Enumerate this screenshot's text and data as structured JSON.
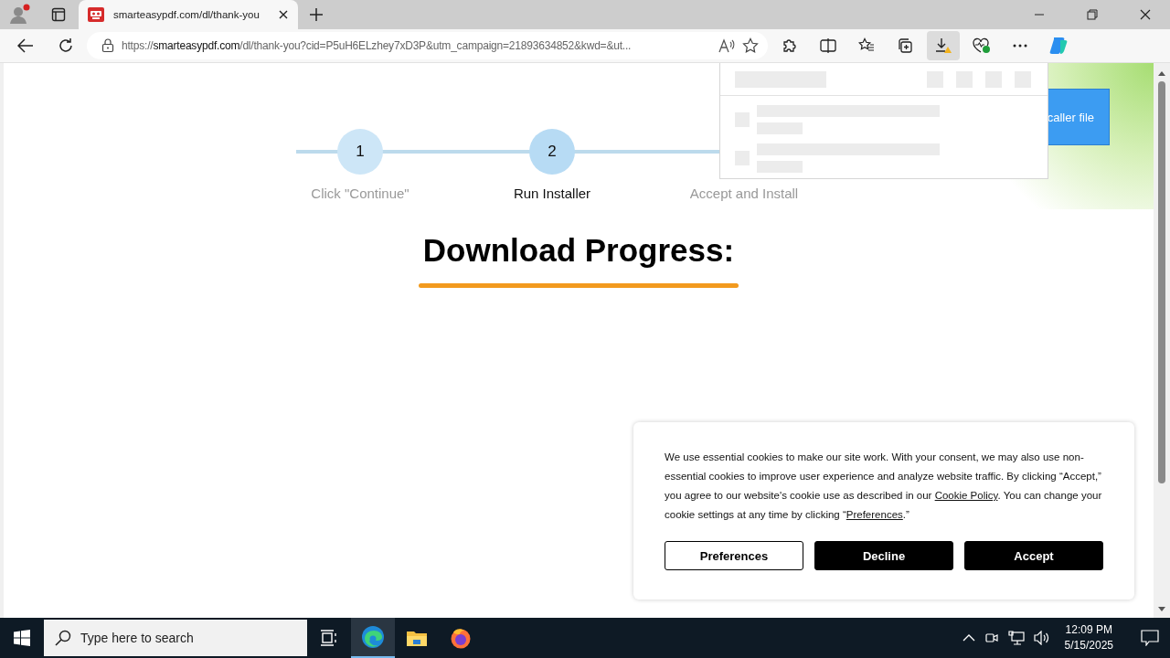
{
  "browser": {
    "tabs": [
      {
        "title": "smarteasypdf.com/dl/thank-you",
        "selected": true
      }
    ],
    "url": {
      "scheme": "https://",
      "host": "smarteasypdf.com",
      "path": "/dl/thank-you?cid=P5uH6ELzhey7xD3P&utm_campaign=21893634852&kwd=&ut..."
    },
    "toolbar": [
      {
        "kind": "extensions",
        "active": false
      },
      {
        "kind": "split",
        "active": false
      },
      {
        "kind": "favorites",
        "active": false
      },
      {
        "kind": "collections",
        "active": false
      },
      {
        "kind": "downloads",
        "active": true
      },
      {
        "kind": "essentials",
        "active": false
      },
      {
        "kind": "more",
        "active": false
      },
      {
        "kind": "copilot",
        "active": false
      }
    ]
  },
  "page": {
    "steps": [
      {
        "number": "1",
        "label": "Click \"Continue\"",
        "current": false
      },
      {
        "number": "2",
        "label": "Run Installer",
        "current": true
      },
      {
        "label": "Accept and Install",
        "current": false
      }
    ],
    "heading": "Download Progress:",
    "tooltip": "caller file"
  },
  "cookie_banner": {
    "text_before": "We use essential cookies to make our site work. With your consent, we may also use non-essential cookies to improve user experience and analyze website traffic. By clicking “Accept,” you agree to our website's cookie use as described in our ",
    "policy_link": "Cookie Policy",
    "text_middle": ". You can change your cookie settings at any time by clicking “",
    "preferences_link": "Preferences",
    "text_after": ".”",
    "buttons": [
      {
        "label": "Preferences",
        "kind": "outline"
      },
      {
        "label": "Decline",
        "kind": "solid"
      },
      {
        "label": "Accept",
        "kind": "solid"
      }
    ]
  },
  "taskbar": {
    "search_placeholder": "Type here to search",
    "apps": [
      {
        "kind": "taskview",
        "selected": false
      },
      {
        "kind": "edge",
        "selected": true
      },
      {
        "kind": "explorer",
        "selected": false
      },
      {
        "kind": "firefox",
        "selected": false
      }
    ],
    "time": "12:09 PM",
    "date": "5/15/2025"
  }
}
